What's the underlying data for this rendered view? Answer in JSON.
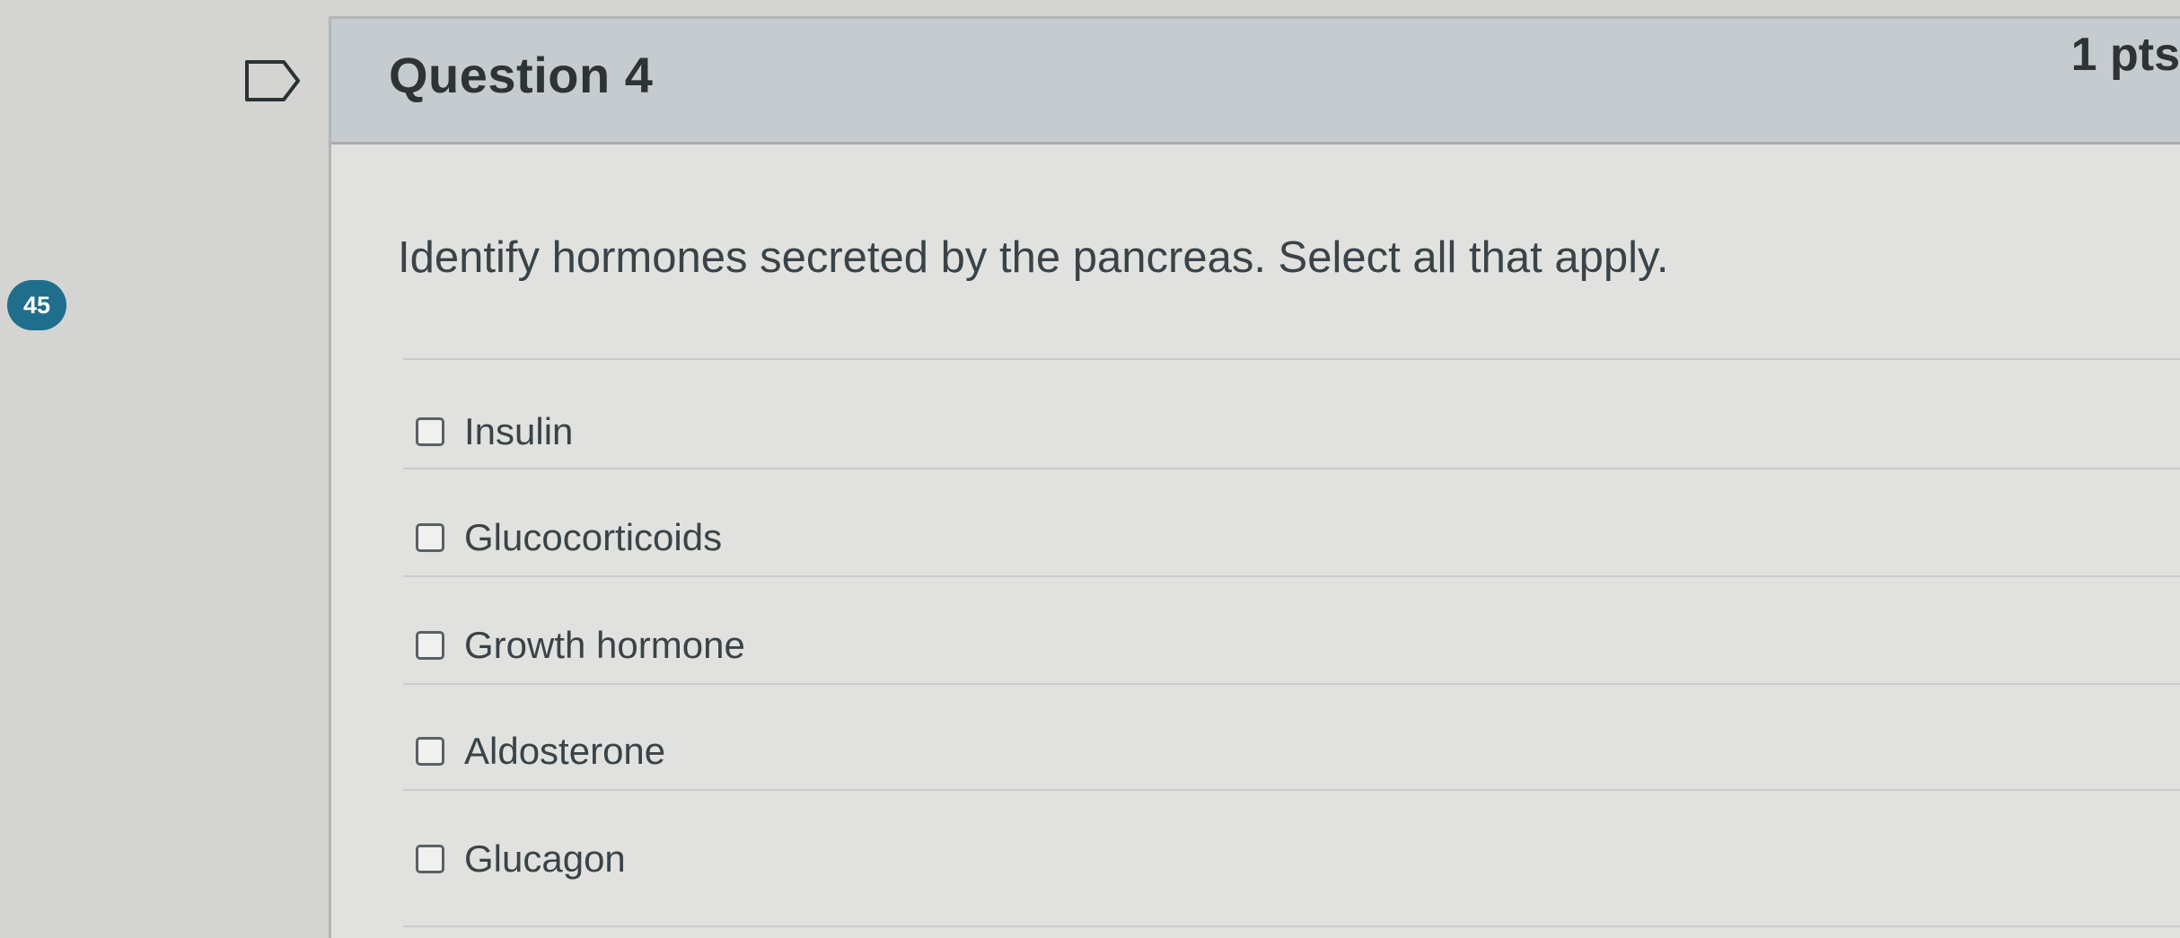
{
  "side_badge": "45",
  "question": {
    "title": "Question 4",
    "points": "1 pts",
    "prompt": "Identify hormones secreted by the pancreas. Select all that apply.",
    "answers": [
      {
        "label": "Insulin",
        "checked": false
      },
      {
        "label": "Glucocorticoids",
        "checked": false
      },
      {
        "label": "Growth hormone",
        "checked": false
      },
      {
        "label": "Aldosterone",
        "checked": false
      },
      {
        "label": "Glucagon",
        "checked": false
      }
    ]
  },
  "colors": {
    "badge": "#1f6e8c",
    "header": "#c6cbd0",
    "text": "#3a4348"
  },
  "icons": {
    "flag": "flag-question-icon"
  }
}
